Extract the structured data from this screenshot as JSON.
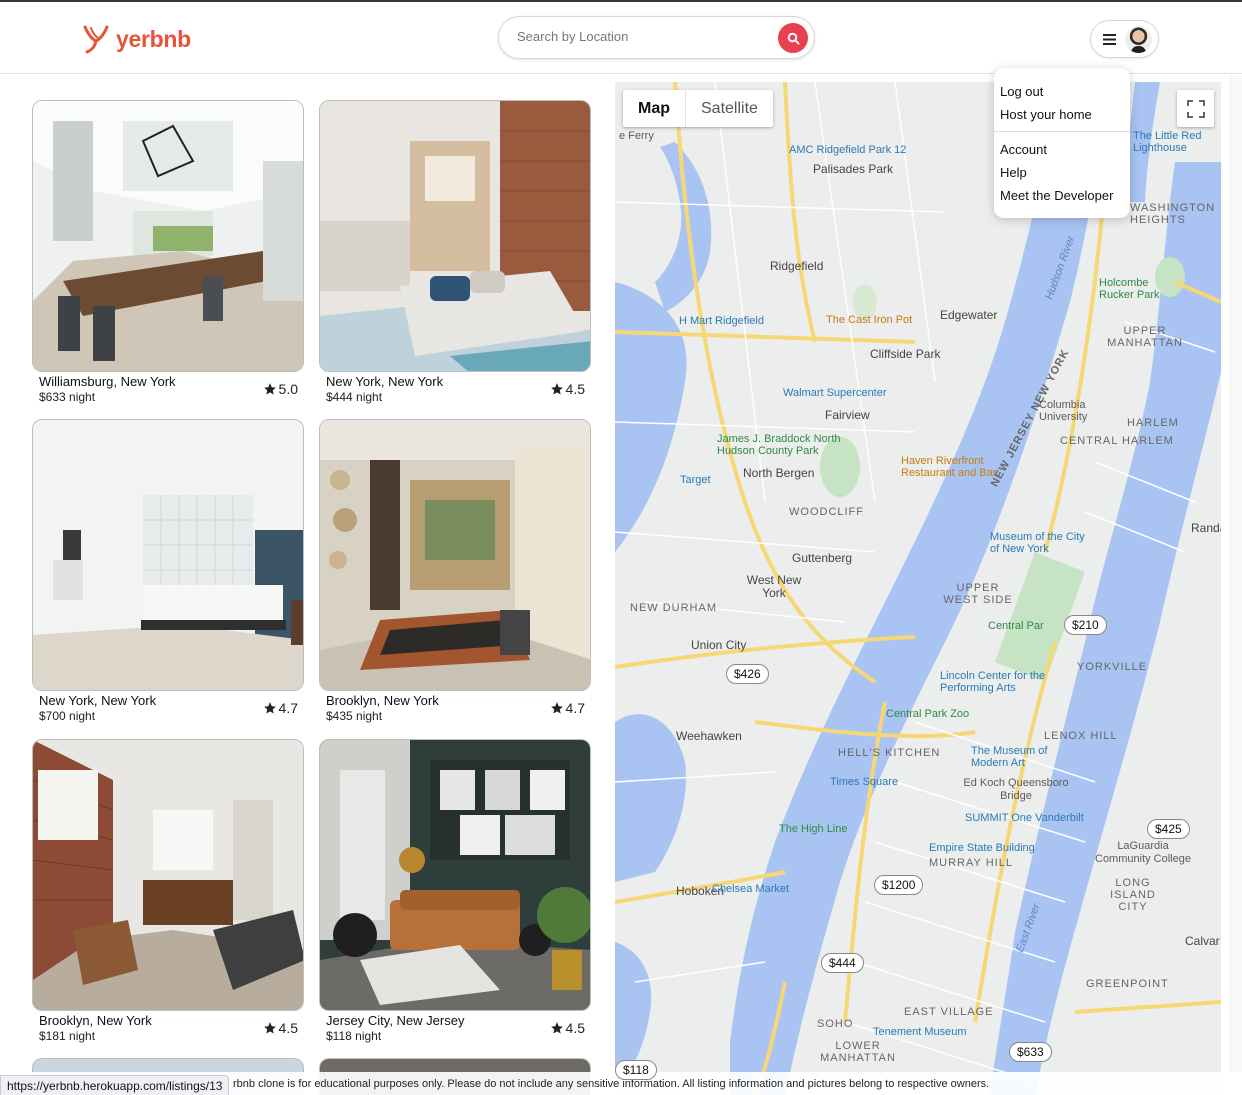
{
  "header": {
    "logo_text": "yerbnb",
    "search_placeholder": "Search by Location"
  },
  "menu": {
    "items_top": [
      "Log out",
      "Host your home"
    ],
    "items_bottom": [
      "Account",
      "Help",
      "Meet the Developer"
    ]
  },
  "listings": [
    {
      "title": "Williamsburg, New York",
      "price": "$633 night",
      "rating": "5.0"
    },
    {
      "title": "New York, New York",
      "price": "$444 night",
      "rating": "4.5"
    },
    {
      "title": "New York, New York",
      "price": "$700 night",
      "rating": "4.7"
    },
    {
      "title": "Brooklyn, New York",
      "price": "$435 night",
      "rating": "4.7"
    },
    {
      "title": "Brooklyn, New York",
      "price": "$181 night",
      "rating": "4.5"
    },
    {
      "title": "Jersey City, New Jersey",
      "price": "$118 night",
      "rating": "4.5"
    }
  ],
  "map": {
    "tab_map": "Map",
    "tab_satellite": "Satellite",
    "price_pins": [
      "$210",
      "$426",
      "$425",
      "$1200",
      "$444",
      "$633",
      "$118"
    ],
    "labels": {
      "ferry": "e Ferry",
      "amc": "AMC Ridgefield Park 12",
      "palisades_park": "Palisades Park",
      "ridgefield": "Ridgefield",
      "hmart": "H Mart Ridgefield",
      "cast_iron": "The Cast Iron Pot",
      "edgewater": "Edgewater",
      "cliffside": "Cliffside Park",
      "walmart": "Walmart Supercenter",
      "fairview": "Fairview",
      "braddock": "James J. Braddock North Hudson County Park",
      "north_bergen": "North Bergen",
      "target": "Target",
      "haven": "Haven Riverfront Restaurant and Bar",
      "woodcliff": "WOODCLIFF",
      "guttenberg": "Guttenberg",
      "west_new_york": "West New York",
      "new_durham": "NEW DURHAM",
      "union_city": "Union City",
      "weehawken": "Weehawken",
      "hoboken": "Hoboken",
      "chelsea_market": "Chelsea Market",
      "high_line": "The High Line",
      "nj_ny": "NEW JERSEY NEW YORK",
      "hudson_river": "Hudson River",
      "little_red": "The Little Red Lighthouse",
      "washington_heights": "WASHINGTON HEIGHTS",
      "holcombe": "Holcombe Rucker Park",
      "upper_manhattan": "UPPER MANHATTAN",
      "columbia": "Columbia University",
      "harlem": "HARLEM",
      "central_harlem": "CENTRAL HARLEM",
      "museum_city": "Museum of the City of New York",
      "upper_west_side": "UPPER WEST SIDE",
      "central_park": "Central Par",
      "yorkville": "YORKVILLE",
      "lincoln_center": "Lincoln Center for the Performing Arts",
      "zoo": "Central Park Zoo",
      "lenox_hill": "LENOX HILL",
      "hells_kitchen": "HELL'S KITCHEN",
      "moma": "The Museum of Modern Art",
      "ed_koch": "Ed Koch Queensboro Bridge",
      "times_square": "Times Square",
      "summit": "SUMMIT One Vanderbilt",
      "empire_state": "Empire State Building",
      "murray_hill": "MURRAY HILL",
      "laguardia": "LaGuardia Community College",
      "long_island_city": "LONG ISLAND CITY",
      "greenpoint": "GREENPOINT",
      "east_village": "EAST VILLAGE",
      "tenement": "Tenement Museum",
      "soho": "SOHO",
      "lower_manhattan": "LOWER MANHATTAN",
      "east_river": "East River",
      "calvar": "Calvar",
      "randa": "Randa"
    }
  },
  "footer": {
    "text": "rbnb clone is for educational purposes only. Please do not include any sensitive information. All listing information and pictures belong to respective owners.",
    "status_url": "https://yerbnb.herokuapp.com/listings/13"
  }
}
